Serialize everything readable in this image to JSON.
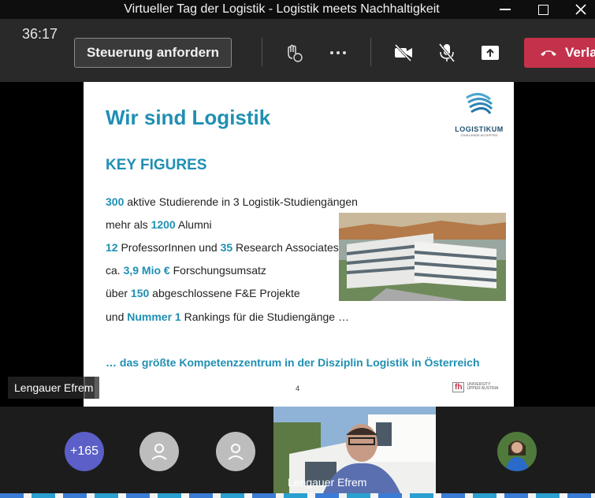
{
  "window": {
    "title": "Virtueller Tag der Logistik - Logistik meets Nachhaltigkeit"
  },
  "toolbar": {
    "timer": "36:17",
    "request_control_label": "Steuerung anfordern",
    "leave_label": "Verla"
  },
  "slide": {
    "title": "Wir sind Logistik",
    "heading": "KEY FIGURES",
    "logo_name": "LOGISTIKUM",
    "logo_tagline": "CHALLENGE ACCEPTED",
    "figures": [
      {
        "pre": "",
        "num": "300",
        "post": " aktive Studierende in 3 Logistik-Studiengängen"
      },
      {
        "pre": "mehr als ",
        "num": "1200",
        "post": " Alumni"
      },
      {
        "pre": "",
        "num": "12",
        "post": " ProfessorInnen und ",
        "num2": "35",
        "post2": " Research Associates"
      },
      {
        "pre": "ca. ",
        "num": "3,9 Mio €",
        "post": " Forschungsumsatz"
      },
      {
        "pre": "über ",
        "num": "150",
        "post": " abgeschlossene F&E Projekte"
      },
      {
        "pre": "und ",
        "num": "Nummer 1",
        "post": " Rankings für die Studiengänge …"
      }
    ],
    "footer": "… das größte Kompetenzzentrum in der Disziplin Logistik in Österreich",
    "page_number": "4",
    "fh_logo": "fh",
    "fh_subtitle_1": "UNIVERSITY",
    "fh_subtitle_2": "UPPER AUSTRIA"
  },
  "presenter": {
    "name": "Lengauer Efrem"
  },
  "gallery": {
    "overflow_count": "+165",
    "video_name": "Lengauer Efrem"
  },
  "colors": {
    "accent": "#1f8fb3",
    "leave": "#c4314b",
    "overflow": "#5b5fc7"
  }
}
